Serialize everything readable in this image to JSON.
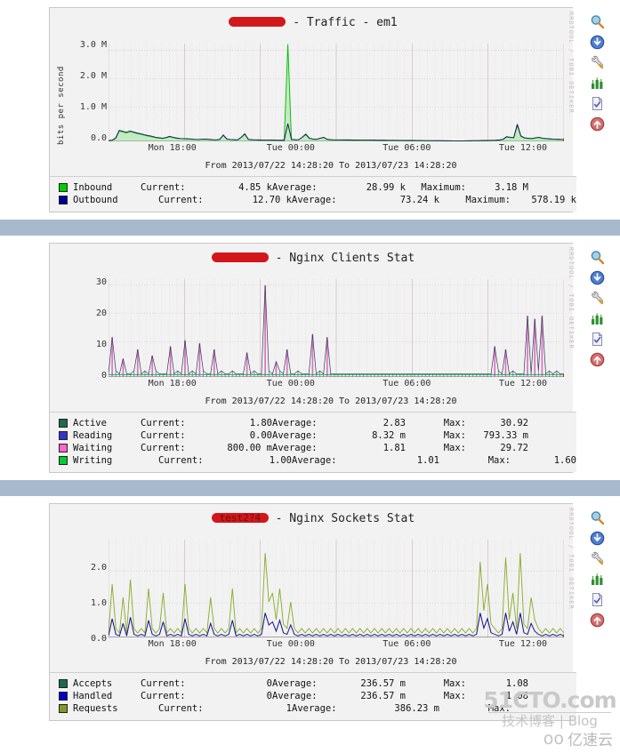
{
  "page": {
    "background": "#ffffff",
    "band_color": "#a9b9cd",
    "watermarks": {
      "site": "51CTO.com",
      "site_sub": "技术博客 | Blog",
      "cloud_logo": "oo",
      "cloud_text": "亿速云"
    }
  },
  "toolbar": {
    "icons": [
      {
        "name": "zoom-icon",
        "glyph": "search",
        "color": "#7fb8d8",
        "title": "Zoom"
      },
      {
        "name": "download-icon",
        "glyph": "arrow-down",
        "color": "#3a6fc4",
        "title": "Download"
      },
      {
        "name": "settings-wrench-icon",
        "glyph": "wrench",
        "color": "#d8d8d8",
        "title": "Settings"
      },
      {
        "name": "bar-chart-icon",
        "glyph": "bars",
        "color": "#2f8f2f",
        "title": "Graph"
      },
      {
        "name": "properties-document-icon",
        "glyph": "document",
        "color": "#e8e8f4",
        "title": "Properties"
      },
      {
        "name": "page-top-icon",
        "glyph": "arrow-up",
        "color": "#c34b4b",
        "title": "Top"
      }
    ]
  },
  "rrd_credit": "RRDTOOL / TOBI OETIKER",
  "time_range": "From 2013/07/22 14:28:20 To 2013/07/23 14:28:20",
  "x_ticks": [
    "Mon 18:00",
    "Tue 00:00",
    "Tue 06:00",
    "Tue 12:00"
  ],
  "panels": [
    {
      "host_redacted": "test2?4",
      "title_suffix": " - Traffic - em1",
      "y_axis_label": "bits per second",
      "y_ticks": [
        "3.0 M",
        "2.0 M",
        "1.0 M",
        "0.0"
      ],
      "legend": [
        {
          "name": "Inbound",
          "color": "#00cc00",
          "k1": "Current:",
          "v1": "4.85 k",
          "k2": "Average:",
          "v2": "28.99 k",
          "k3": "Maximum:",
          "v3": "3.18 M"
        },
        {
          "name": "Outbound",
          "color": "#000099",
          "k1": "Current:",
          "v1": "12.70 k",
          "k2": "Average:",
          "v2": "73.24 k",
          "k3": "Maximum:",
          "v3": "578.19 k"
        }
      ]
    },
    {
      "host_redacted": "test2?4",
      "title_suffix": " - Nginx Clients Stat",
      "y_axis_label": "",
      "y_ticks": [
        "30",
        "20",
        "10",
        "0"
      ],
      "legend": [
        {
          "name": "Active",
          "color": "#1d6b4a",
          "k1": "Current:",
          "v1": "1.80",
          "k2": "Average:",
          "v2": "2.83",
          "k3": "Max:",
          "v3": "30.92"
        },
        {
          "name": "Reading",
          "color": "#3333cc",
          "k1": "Current:",
          "v1": "0.00",
          "k2": "Average:",
          "v2": "8.32 m",
          "k3": "Max:",
          "v3": "793.33 m"
        },
        {
          "name": "Waiting",
          "color": "#ff66cc",
          "k1": "Current:",
          "v1": "800.00 m",
          "k2": "Average:",
          "v2": "1.81",
          "k3": "Max:",
          "v3": "29.72"
        },
        {
          "name": "Writing",
          "color": "#00cc33",
          "k1": "Current:",
          "v1": "1.00",
          "k2": "Average:",
          "v2": "1.01",
          "k3": "Max:",
          "v3": "1.60"
        }
      ]
    },
    {
      "host_redacted": "test2?4",
      "title_suffix": " - Nginx Sockets Stat",
      "y_axis_label": "",
      "y_ticks": [
        "2.0",
        "1.0",
        "0.0"
      ],
      "legend": [
        {
          "name": "Accepts",
          "color": "#1d6b4a",
          "k1": "Current:",
          "v1": "0",
          "k2": "Average:",
          "v2": "236.57 m",
          "k3": "Max:",
          "v3": "1.08"
        },
        {
          "name": "Handled",
          "color": "#0000cc",
          "k1": "Current:",
          "v1": "0",
          "k2": "Average:",
          "v2": "236.57 m",
          "k3": "Max:",
          "v3": "1.08"
        },
        {
          "name": "Requests",
          "color": "#7d9a28",
          "k1": "Current:",
          "v1": "1",
          "k2": "Average:",
          "v2": "386.23 m",
          "k3": "Max:",
          "v3": ""
        }
      ]
    }
  ],
  "chart_data": [
    {
      "type": "area",
      "title": "test2?4 - Traffic - em1",
      "ylabel": "bits per second",
      "xlabel": "",
      "ylim": [
        0,
        3200000
      ],
      "y_tick_values": [
        0,
        1000000,
        2000000,
        3000000
      ],
      "y_tick_labels": [
        "0.0",
        "1.0 M",
        "2.0 M",
        "3.0 M"
      ],
      "x_tick_labels": [
        "Mon 18:00",
        "Tue 00:00",
        "Tue 06:00",
        "Tue 12:00"
      ],
      "grid": true,
      "legend_position": "below",
      "series": [
        {
          "name": "Inbound",
          "color": "#00cc00",
          "fill": true,
          "current": 4850,
          "average": 28990,
          "maximum": 3180000,
          "values": [
            20000,
            30000,
            90000,
            340000,
            300000,
            280000,
            310000,
            290000,
            250000,
            230000,
            200000,
            170000,
            150000,
            120000,
            100000,
            90000,
            110000,
            150000,
            120000,
            95000,
            85000,
            80000,
            75000,
            70000,
            60000,
            55000,
            65000,
            70000,
            60000,
            50000,
            45000,
            60000,
            190000,
            70000,
            55000,
            50000,
            45000,
            120000,
            230000,
            60000,
            50000,
            45000,
            40000,
            38000,
            36000,
            35000,
            34000,
            33000,
            32000,
            31000,
            3180000,
            60000,
            50000,
            48000,
            120000,
            220000,
            95000,
            70000,
            60000,
            95000,
            120000,
            60000,
            50000,
            45000,
            44000,
            43000,
            42000,
            41000,
            40000,
            39000,
            38000,
            37000,
            36000,
            35000,
            34000,
            33000,
            32000,
            31000,
            30000,
            29000,
            28000,
            27000,
            26000,
            25000,
            24000,
            23000,
            22000,
            21000,
            20000,
            19000,
            18000,
            17000,
            16000,
            15000,
            14000,
            13000,
            12000,
            11000,
            10000,
            12000,
            14000,
            16000,
            18000,
            20000,
            22000,
            24000,
            26000,
            28000,
            30000,
            40000,
            60000,
            140000,
            120000,
            110000,
            520000,
            160000,
            100000,
            90000,
            80000,
            100000,
            120000,
            90000,
            80000,
            70000,
            65000,
            60000,
            58000,
            56000
          ]
        },
        {
          "name": "Outbound",
          "color": "#000099",
          "fill": false,
          "current": 12700,
          "average": 73240,
          "maximum": 578190,
          "values": [
            25000,
            40000,
            110000,
            360000,
            330000,
            300000,
            340000,
            310000,
            270000,
            250000,
            220000,
            190000,
            170000,
            140000,
            120000,
            105000,
            125000,
            165000,
            135000,
            110000,
            95000,
            90000,
            85000,
            80000,
            70000,
            62000,
            72000,
            78000,
            68000,
            58000,
            52000,
            68000,
            210000,
            80000,
            62000,
            56000,
            52000,
            135000,
            250000,
            68000,
            58000,
            52000,
            48000,
            45000,
            43000,
            42000,
            41000,
            40000,
            39000,
            38000,
            578190,
            70000,
            58000,
            55000,
            135000,
            240000,
            105000,
            80000,
            68000,
            105000,
            135000,
            68000,
            58000,
            52000,
            51000,
            50000,
            49000,
            48000,
            47000,
            46000,
            45000,
            44000,
            43000,
            42000,
            41000,
            40000,
            39000,
            38000,
            37000,
            36000,
            35000,
            34000,
            33000,
            32000,
            31000,
            30000,
            29000,
            28000,
            27000,
            26000,
            25000,
            24000,
            23000,
            22000,
            21000,
            20000,
            19000,
            18000,
            17000,
            19000,
            21000,
            23000,
            25000,
            27000,
            29000,
            31000,
            33000,
            35000,
            38000,
            48000,
            70000,
            155000,
            135000,
            125000,
            560000,
            180000,
            115000,
            105000,
            95000,
            115000,
            135000,
            105000,
            95000,
            85000,
            78000,
            72000,
            68000,
            65000
          ]
        }
      ]
    },
    {
      "type": "line",
      "title": "test2?4 - Nginx Clients Stat",
      "ylabel": "",
      "xlabel": "",
      "ylim": [
        0,
        32
      ],
      "y_tick_values": [
        0,
        10,
        20,
        30
      ],
      "y_tick_labels": [
        "0",
        "10",
        "20",
        "30"
      ],
      "x_tick_labels": [
        "Mon 18:00",
        "Tue 00:00",
        "Tue 06:00",
        "Tue 12:00"
      ],
      "grid": true,
      "legend_position": "below",
      "series": [
        {
          "name": "Active",
          "color": "#1d6b4a",
          "current": 1.8,
          "average": 2.83,
          "max": 30.92
        },
        {
          "name": "Reading",
          "color": "#3333cc",
          "current": 0.0,
          "average": 0.00832,
          "max": 0.79333
        },
        {
          "name": "Waiting",
          "color": "#ff66cc",
          "current": 0.8,
          "average": 1.81,
          "max": 29.72,
          "values": [
            1,
            13,
            2,
            1,
            6,
            1,
            1,
            2,
            9,
            1,
            2,
            1,
            7,
            2,
            1,
            1,
            1,
            10,
            1,
            2,
            1,
            12,
            1,
            2,
            1,
            11,
            2,
            1,
            1,
            9,
            1,
            2,
            1,
            1,
            2,
            1,
            1,
            1,
            8,
            1,
            2,
            1,
            1,
            30,
            2,
            1,
            5,
            2,
            1,
            9,
            1,
            1,
            2,
            1,
            1,
            1,
            14,
            1,
            2,
            1,
            13,
            1,
            1,
            1,
            1,
            1,
            1,
            1,
            1,
            1,
            1,
            1,
            1,
            1,
            1,
            1,
            1,
            1,
            1,
            1,
            1,
            1,
            1,
            1,
            1,
            1,
            1,
            1,
            1,
            1,
            1,
            1,
            1,
            1,
            1,
            1,
            1,
            1,
            1,
            1,
            1,
            1,
            1,
            1,
            1,
            1,
            10,
            2,
            1,
            9,
            1,
            2,
            1,
            1,
            1,
            20,
            1,
            19,
            2,
            20,
            1,
            2,
            1,
            2,
            1,
            1
          ]
        },
        {
          "name": "Writing",
          "color": "#00cc33",
          "current": 1.0,
          "average": 1.01,
          "max": 1.6
        }
      ]
    },
    {
      "type": "line",
      "title": "test2?4 - Nginx Sockets Stat",
      "ylabel": "",
      "xlabel": "",
      "ylim": [
        0,
        2.2
      ],
      "y_tick_values": [
        0,
        1,
        2
      ],
      "y_tick_labels": [
        "0.0",
        "1.0",
        "2.0"
      ],
      "x_tick_labels": [
        "Mon 18:00",
        "Tue 00:00",
        "Tue 06:00",
        "Tue 12:00"
      ],
      "grid": true,
      "legend_position": "below",
      "series": [
        {
          "name": "Accepts",
          "color": "#1d6b4a",
          "current": 0,
          "average": 0.23657,
          "max": 1.08
        },
        {
          "name": "Handled",
          "color": "#0000cc",
          "current": 0,
          "average": 0.23657,
          "max": 1.08
        },
        {
          "name": "Requests",
          "color": "#7d9a28",
          "current": 1,
          "average": 0.38623,
          "max": null,
          "values": [
            0.1,
            1.2,
            0.2,
            0.1,
            0.9,
            0.1,
            1.3,
            0.2,
            0.1,
            0.2,
            0.1,
            1.1,
            0.2,
            0.1,
            0.2,
            1.0,
            0.1,
            0.2,
            0.1,
            0.2,
            0.1,
            1.2,
            0.2,
            0.1,
            0.2,
            0.1,
            0.2,
            0.1,
            0.9,
            0.2,
            0.1,
            0.2,
            0.1,
            0.2,
            1.1,
            0.1,
            0.2,
            0.1,
            0.2,
            0.1,
            0.2,
            0.1,
            0.2,
            1.9,
            0.8,
            1.0,
            0.4,
            1.1,
            0.3,
            0.2,
            0.8,
            0.2,
            0.1,
            0.2,
            0.1,
            0.2,
            0.1,
            0.2,
            0.1,
            0.2,
            0.1,
            0.2,
            0.1,
            0.2,
            0.1,
            0.2,
            0.1,
            0.2,
            0.1,
            0.2,
            0.1,
            0.2,
            0.1,
            0.2,
            0.1,
            0.2,
            0.1,
            0.2,
            0.1,
            0.2,
            0.1,
            0.2,
            0.1,
            0.2,
            0.1,
            0.2,
            0.1,
            0.2,
            0.1,
            0.2,
            0.1,
            0.2,
            0.1,
            0.2,
            0.1,
            0.2,
            0.1,
            0.2,
            0.1,
            0.2,
            0.1,
            0.2,
            1.7,
            0.6,
            1.2,
            0.3,
            0.2,
            0.1,
            0.2,
            1.8,
            0.4,
            1.0,
            0.2,
            1.9,
            0.3,
            0.2,
            0.9,
            0.4,
            0.2,
            0.1,
            0.2,
            0.1,
            0.2,
            0.1,
            0.2,
            0.1
          ]
        }
      ]
    }
  ]
}
